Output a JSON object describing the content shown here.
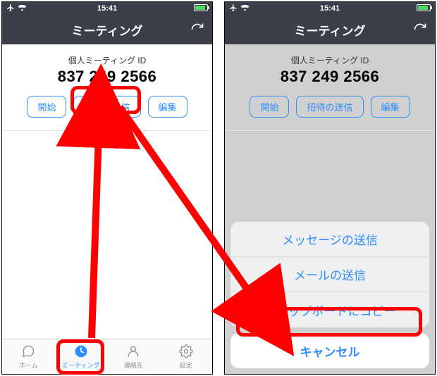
{
  "status": {
    "time": "15:41"
  },
  "nav": {
    "title": "ミーティング"
  },
  "meeting": {
    "pmi_label": "個人ミーティング ID",
    "pmi_value": "837 249 2566",
    "start_label": "開始",
    "send_invite_label": "招待の送信",
    "edit_label": "編集"
  },
  "tabs": {
    "home": "ホーム",
    "meeting": "ミーティング",
    "contacts": "連絡先",
    "settings": "設定"
  },
  "sheet": {
    "send_message": "メッセージの送信",
    "send_mail": "メールの送信",
    "copy_clipboard": "クリップボードにコピー",
    "cancel": "キャンセル"
  }
}
